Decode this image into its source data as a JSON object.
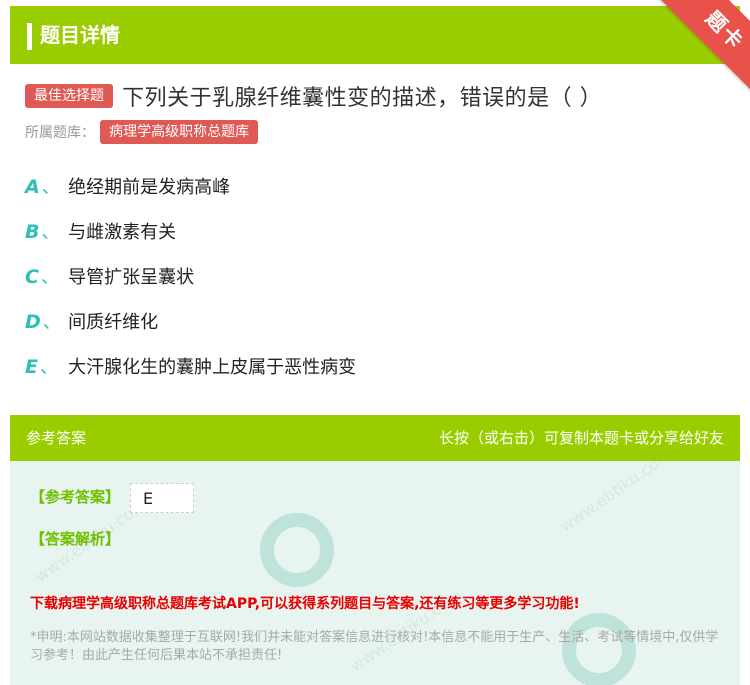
{
  "header": {
    "title": "题目详情",
    "ribbon": "题卡"
  },
  "question": {
    "type_tag": "最佳选择题",
    "text": "下列关于乳腺纤维囊性变的描述，错误的是（      ）",
    "bank_label": "所属题库：",
    "bank_name": "病理学高级职称总题库"
  },
  "options": [
    {
      "letter": "A",
      "sep": "、",
      "text": "绝经期前是发病高峰"
    },
    {
      "letter": "B",
      "sep": "、",
      "text": "与雌激素有关"
    },
    {
      "letter": "C",
      "sep": "、",
      "text": "导管扩张呈囊状"
    },
    {
      "letter": "D",
      "sep": "、",
      "text": "间质纤维化"
    },
    {
      "letter": "E",
      "sep": "、",
      "text": "大汗腺化生的囊肿上皮属于恶性病变"
    }
  ],
  "answer_panel": {
    "header_left": "参考答案",
    "header_right": "长按（或右击）可复制本题卡或分享给好友",
    "ref_label": "【参考答案】",
    "ref_value": "E",
    "analysis_label": "【答案解析】",
    "download_text": "下载病理学高级职称总题库考试APP,可以获得系列题目与答案,还有练习等更多学习功能!",
    "notice": "*申明:本网站数据收集整理于互联网!我们并未能对答案信息进行核对!本信息不能用于生产、生活、考试等情境中,仅供学习参考！由此产生任何后果本站不承担责任!"
  },
  "colors": {
    "green": "#9acd00",
    "red": "#e05a55",
    "teal": "#2ec0b4"
  }
}
